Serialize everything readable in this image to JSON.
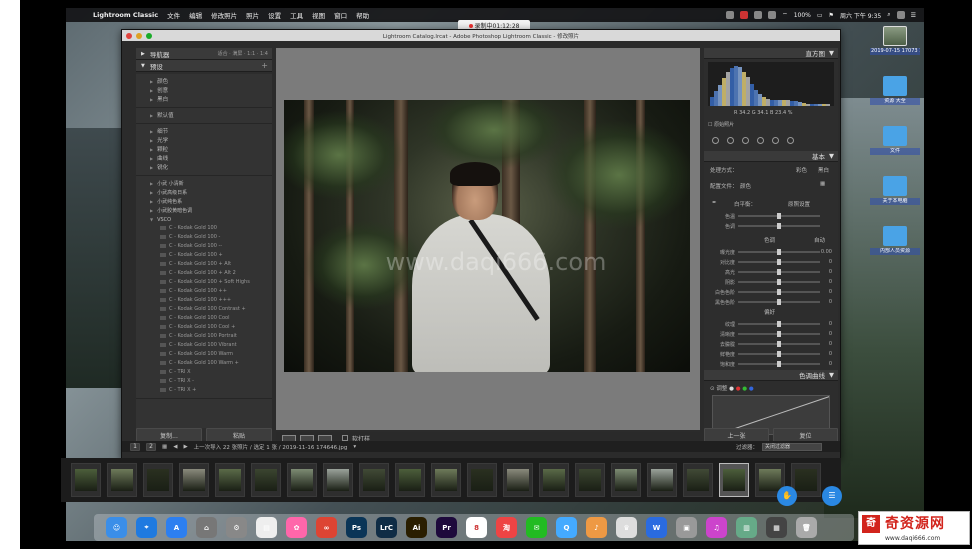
{
  "menubar": {
    "apple": "",
    "items": [
      "Lightroom Classic",
      "文件",
      "编辑",
      "修改照片",
      "照片",
      "设置",
      "工具",
      "视图",
      "窗口",
      "帮助"
    ],
    "right": {
      "battery": "100%",
      "time": "周六 下午 9:35"
    }
  },
  "recording": {
    "label": "录制中01:12:28"
  },
  "window": {
    "title": "Lightroom Catalog.lrcat - Adobe Photoshop Lightroom Classic - 修改照片"
  },
  "desktop": {
    "icons": [
      {
        "label": "2019-07-15 17073 1.jpg",
        "kind": "photo"
      },
      {
        "label": "资源 大全",
        "kind": "folder"
      },
      {
        "label": "文件",
        "kind": "folder"
      },
      {
        "label": "关于本电脑",
        "kind": "folder"
      },
      {
        "label": "内部人员资源",
        "kind": "folder"
      }
    ]
  },
  "left_panel": {
    "navigator": {
      "title": "导航器",
      "opts": "适合 · 满屏 · 1:1 · 1:4"
    },
    "presets_title": "预设",
    "groups": [
      [
        "颜色",
        "创意",
        "黑白"
      ],
      [
        "默认值"
      ],
      [
        "细节",
        "光学",
        "颗粒",
        "曲线",
        "锐化"
      ]
    ],
    "user_groups": [
      "小武 小清新",
      "小武高级日系",
      "小武纯色系",
      "小武胶黄暗色调",
      "VSCO"
    ],
    "vsco": [
      "C - Kodak Gold 100",
      "C - Kodak Gold 100 -",
      "C - Kodak Gold 100 --",
      "C - Kodak Gold 100 +",
      "C - Kodak Gold 100 + Alt",
      "C - Kodak Gold 100 + Alt 2",
      "C - Kodak Gold 100 + Soft Highs",
      "C - Kodak Gold 100 ++",
      "C - Kodak Gold 100 +++",
      "C - Kodak Gold 100 Contrast +",
      "C - Kodak Gold 100 Cool",
      "C - Kodak Gold 100 Cool +",
      "C - Kodak Gold 100 Portrait",
      "C - Kodak Gold 100 Vibrant",
      "C - Kodak Gold 100 Warm",
      "C - Kodak Gold 100 Warm +",
      "C - TRI X",
      "C - TRI X -",
      "C - TRI X +"
    ],
    "copy_btn": "复制...",
    "paste_btn": "粘贴"
  },
  "center": {
    "watermark": "www.daqi666.com",
    "toolbar": {
      "softproof": "软打样"
    }
  },
  "right_panel": {
    "histogram_title": "直方图",
    "hist_values": "R 34.2  G 34.1  B 23.4 %",
    "original_photo": "原始照片",
    "basic_title": "基本",
    "treatment": {
      "label": "处理方式：",
      "color": "彩色",
      "bw": "黑白"
    },
    "profile": {
      "label": "配置文件：",
      "value": "颜色"
    },
    "wb": {
      "label": "白平衡：",
      "value": "原照设置"
    },
    "wb_sliders": [
      {
        "label": "色温",
        "pos": 0.5,
        "val": ""
      },
      {
        "label": "色调",
        "pos": 0.5,
        "val": ""
      }
    ],
    "tone": {
      "label": "色调",
      "auto": "自动"
    },
    "tone_sliders": [
      {
        "label": "曝光度",
        "pos": 0.5,
        "val": "0.00"
      },
      {
        "label": "对比度",
        "pos": 0.5,
        "val": "0"
      },
      {
        "label": "高光",
        "pos": 0.5,
        "val": "0"
      },
      {
        "label": "阴影",
        "pos": 0.5,
        "val": "0"
      },
      {
        "label": "白色色阶",
        "pos": 0.5,
        "val": "0"
      },
      {
        "label": "黑色色阶",
        "pos": 0.5,
        "val": "0"
      }
    ],
    "presence": {
      "label": "偏好"
    },
    "presence_sliders": [
      {
        "label": "纹理",
        "pos": 0.5,
        "val": "0"
      },
      {
        "label": "清晰度",
        "pos": 0.5,
        "val": "0"
      },
      {
        "label": "去朦胧",
        "pos": 0.5,
        "val": "0"
      },
      {
        "label": "鲜艳度",
        "pos": 0.5,
        "val": "0"
      },
      {
        "label": "饱和度",
        "pos": 0.5,
        "val": "0"
      }
    ],
    "curve_title": "色调曲线",
    "curve_label": "调整",
    "prev_btn": "上一张",
    "reset_btn": "复位"
  },
  "filmbar": {
    "pages": [
      "1",
      "2"
    ],
    "info": "上一次导入  22 张照片 / 选定 1 张 / 2019-11-16 174646.jpg",
    "filter_label": "过滤器：",
    "filter_value": "关闭过滤器"
  },
  "filmstrip": {
    "count": 21,
    "selected": 18
  },
  "dock": {
    "items": [
      "Finder",
      "Safari",
      "App Store",
      "Launchpad",
      "Settings",
      "Preview",
      "Photos",
      "CC",
      "Ps",
      "LrC",
      "Ai",
      "Pr",
      "8",
      "淘宝",
      "WeChat",
      "QQ",
      "Store",
      "Ms",
      "W",
      "Folder",
      "iTunes",
      "Img",
      "Files",
      "Trash"
    ]
  },
  "site_logo": {
    "text": "奇资源网",
    "url": "www.daqi666.com",
    "mark": "奇"
  },
  "colors": {
    "accent": "#2a88e3",
    "logo": "#d2241c"
  }
}
